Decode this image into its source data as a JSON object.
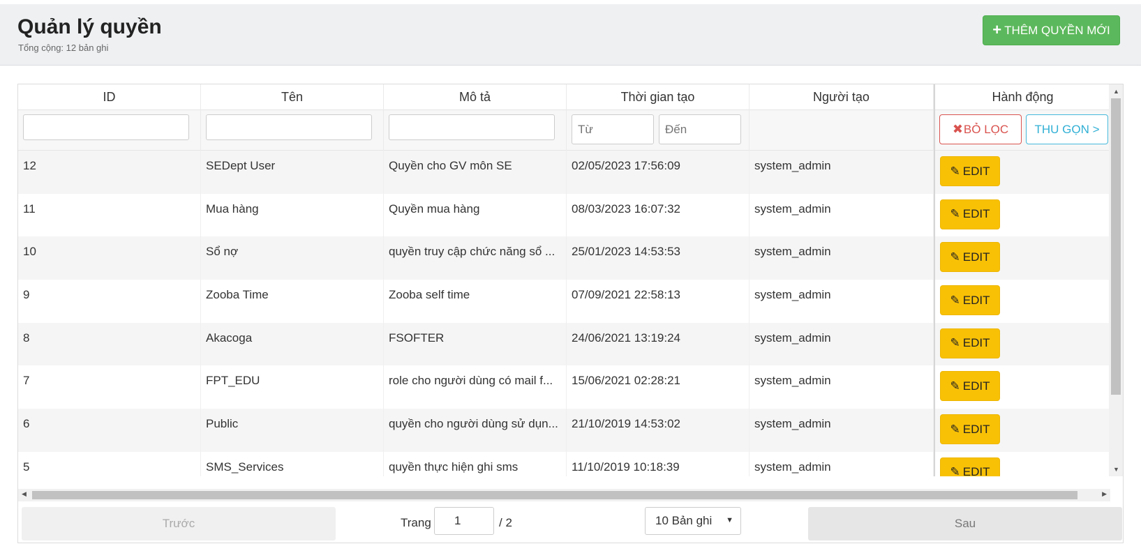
{
  "header": {
    "title": "Quản lý quyền",
    "subtitle": "Tổng cộng: 12 bản ghi",
    "add_button_label": "THÊM QUYỀN MỚI",
    "accent_color": "#5cb85c"
  },
  "table": {
    "columns": [
      "ID",
      "Tên",
      "Mô tả",
      "Thời gian tạo",
      "Người tạo",
      "Hành động"
    ],
    "filters": {
      "time_from_placeholder": "Từ",
      "time_to_placeholder": "Đến",
      "clear_button_label": "BỎ LỌC",
      "collapse_button_label": "THU GỌN >"
    },
    "edit_label": "EDIT",
    "rows": [
      {
        "id": "12",
        "name": "SEDept User",
        "desc": "Quyền cho GV môn SE",
        "time": "02/05/2023 17:56:09",
        "user": "system_admin"
      },
      {
        "id": "11",
        "name": "Mua hàng",
        "desc": "Quyền mua hàng",
        "time": "08/03/2023 16:07:32",
        "user": "system_admin"
      },
      {
        "id": "10",
        "name": "Sổ nợ",
        "desc": "quyền truy cập chức năng sổ ...",
        "time": "25/01/2023 14:53:53",
        "user": "system_admin"
      },
      {
        "id": "9",
        "name": "Zooba Time",
        "desc": "Zooba self time",
        "time": "07/09/2021 22:58:13",
        "user": "system_admin"
      },
      {
        "id": "8",
        "name": "Akacoga",
        "desc": "FSOFTER",
        "time": "24/06/2021 13:19:24",
        "user": "system_admin"
      },
      {
        "id": "7",
        "name": "FPT_EDU",
        "desc": "role cho người dùng có mail f...",
        "time": "15/06/2021 02:28:21",
        "user": "system_admin"
      },
      {
        "id": "6",
        "name": "Public",
        "desc": "quyền cho người dùng sử dụn...",
        "time": "21/10/2019 14:53:02",
        "user": "system_admin"
      },
      {
        "id": "5",
        "name": "SMS_Services",
        "desc": "quyền thực hiện ghi sms",
        "time": "11/10/2019 10:18:39",
        "user": "system_admin"
      }
    ]
  },
  "pagination": {
    "prev_label": "Trước",
    "next_label": "Sau",
    "page_label": "Trang",
    "current_page": "1",
    "total_pages": "/ 2",
    "page_size_label": "10 Bản ghi"
  }
}
